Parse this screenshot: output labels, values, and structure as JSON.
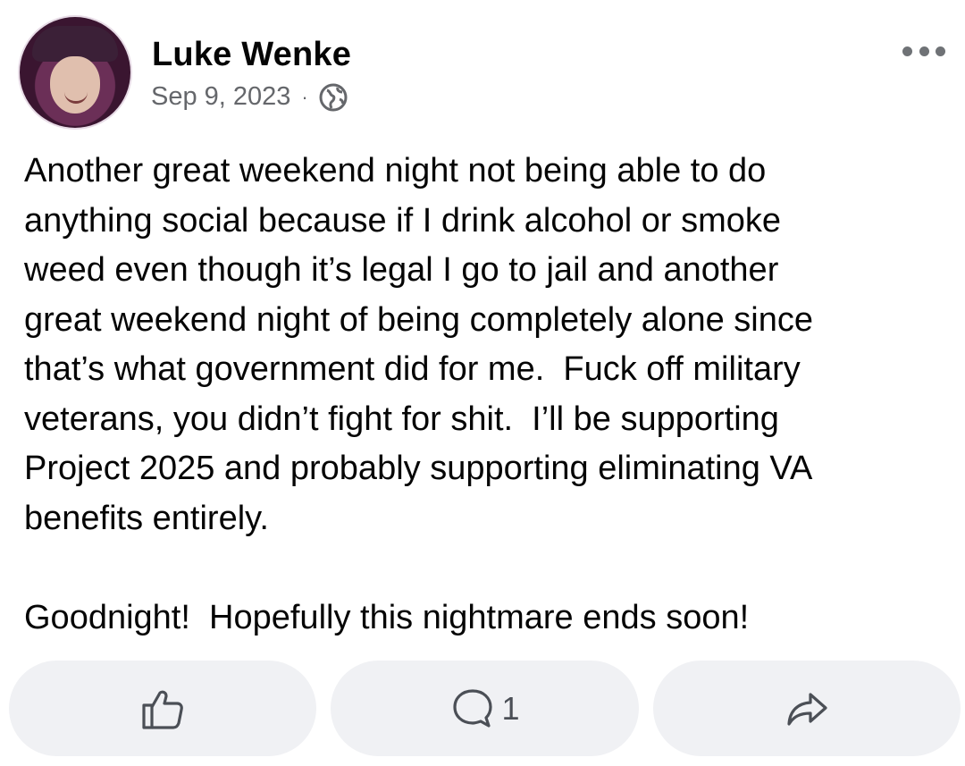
{
  "post": {
    "author": "Luke Wenke",
    "date": "Sep 9, 2023",
    "separator": "·",
    "privacy_icon": "globe-icon",
    "more_icon": "more-options-icon",
    "text": "Another great weekend night not being able to do\nanything social because if I drink alcohol or smoke\nweed even though it’s legal I go to jail and another\ngreat weekend night of being completely alone since\nthat’s what government did for me.  Fuck off military\nveterans, you didn’t fight for shit.  I’ll be supporting\nProject 2025 and probably supporting eliminating VA\nbenefits entirely.\n\nGoodnight!  Hopefully this nightmare ends soon!"
  },
  "actions": {
    "like_icon": "thumbs-up-icon",
    "comment_icon": "comment-icon",
    "comment_count": "1",
    "share_icon": "share-icon"
  },
  "colors": {
    "text": "#050505",
    "secondary_text": "#65676b",
    "action_bg": "#f0f1f4",
    "icon": "#4b4f56"
  }
}
